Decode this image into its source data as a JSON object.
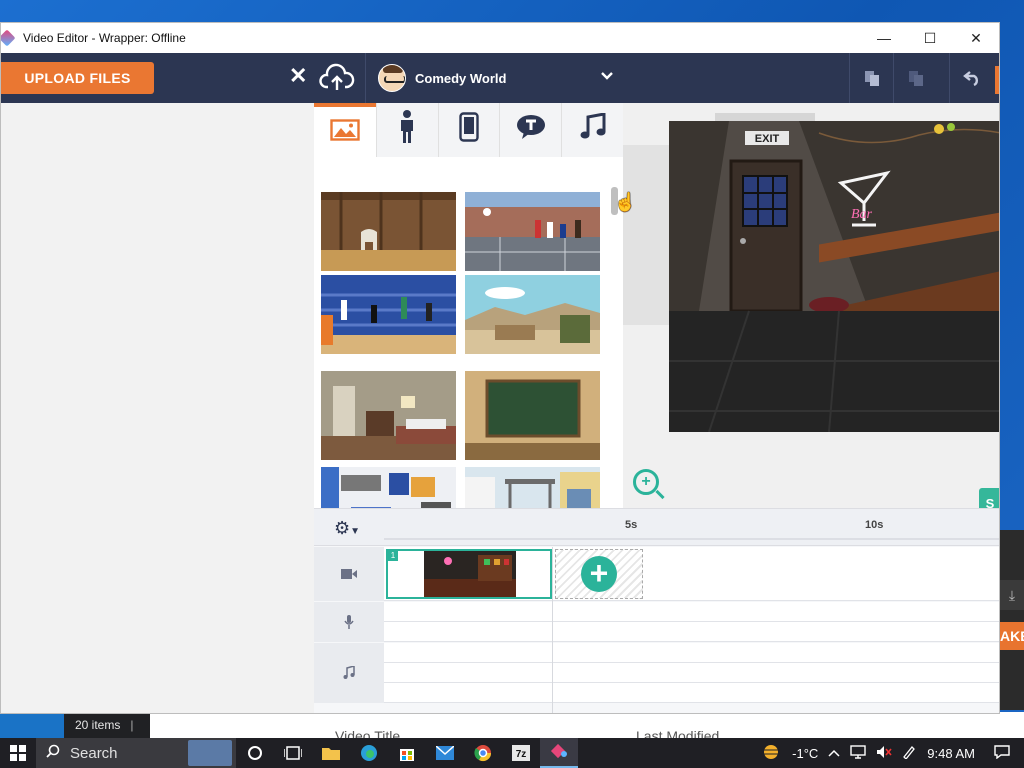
{
  "window": {
    "title": "Video Editor - Wrapper: Offline",
    "minimize": "—",
    "maximize": "☐",
    "close": "✕"
  },
  "header": {
    "upload_label": "UPLOAD FILES",
    "close_symbol": "✕",
    "theme_name": "Comedy World"
  },
  "library": {
    "tabs": [
      "image-icon",
      "person-icon",
      "phone-icon",
      "speech-bubble-icon",
      "music-icon"
    ],
    "active_tab": 0
  },
  "timeline": {
    "ticks": [
      "5s",
      "10s"
    ],
    "scene_number": "1"
  },
  "desktop": {
    "status_items": "20 items",
    "status_sep": "|",
    "col_video_title": "Video Title",
    "col_last_modified": "Last Modified",
    "peek_label": "AKE"
  },
  "taskbar": {
    "search_label": "Search",
    "temperature": "-1°C",
    "time": "9:48 AM"
  },
  "colors": {
    "accent": "#ea7732",
    "header": "#2c3652",
    "teal": "#2bb39a"
  }
}
